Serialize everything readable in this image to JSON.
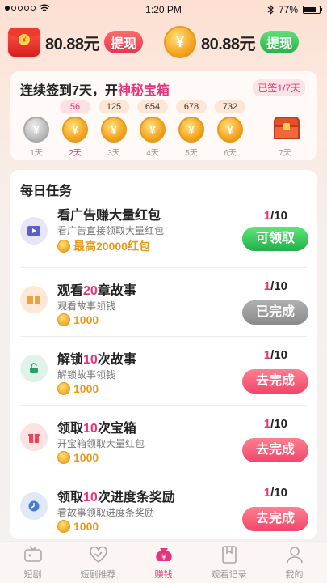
{
  "status": {
    "time": "1:20 PM",
    "battery": "77%",
    "battery_level": 0.77
  },
  "balances": [
    {
      "amount": "80.88元",
      "button": "提现",
      "coin_glyph": "¥"
    },
    {
      "amount": "80.88元",
      "button": "提现",
      "coin_glyph": "¥"
    }
  ],
  "signin": {
    "title_prefix": "连续签到7天，开",
    "title_highlight": "神秘宝箱",
    "badge": "已签1/7天",
    "days": [
      {
        "reward": "",
        "label": "1天",
        "state": "done"
      },
      {
        "reward": "56",
        "label": "2天",
        "state": "today"
      },
      {
        "reward": "125",
        "label": "3天",
        "state": "pending"
      },
      {
        "reward": "654",
        "label": "4天",
        "state": "pending"
      },
      {
        "reward": "678",
        "label": "5天",
        "state": "pending"
      },
      {
        "reward": "732",
        "label": "6天",
        "state": "pending"
      },
      {
        "reward": "",
        "label": "7天",
        "state": "chest"
      }
    ]
  },
  "tasks": {
    "title": "每日任务",
    "items": [
      {
        "name_a": "看广告赚大量红包",
        "name_b": "",
        "name_c": "",
        "desc": "看广告直接领取大量红包",
        "reward": "最高20000红包",
        "done": "1",
        "total": "/10",
        "action": "可领取",
        "action_style": "green",
        "icon": "video-icon"
      },
      {
        "name_a": "观看",
        "name_b": "20",
        "name_c": "章故事",
        "desc": "观看故事领钱",
        "reward": "1000",
        "done": "1",
        "total": "/10",
        "action": "已完成",
        "action_style": "gray",
        "icon": "book-icon"
      },
      {
        "name_a": "解锁",
        "name_b": "10",
        "name_c": "次故事",
        "desc": "解锁故事领钱",
        "reward": "1000",
        "done": "1",
        "total": "/10",
        "action": "去完成",
        "action_style": "pink",
        "icon": "unlock-icon"
      },
      {
        "name_a": "领取",
        "name_b": "10",
        "name_c": "次宝箱",
        "desc": "开宝箱领取大量红包",
        "reward": "1000",
        "done": "1",
        "total": "/10",
        "action": "去完成",
        "action_style": "pink",
        "icon": "gift-icon"
      },
      {
        "name_a": "领取",
        "name_b": "10",
        "name_c": "次进度条奖励",
        "desc": "看故事领取进度条奖励",
        "reward": "1000",
        "done": "1",
        "total": "/10",
        "action": "去完成",
        "action_style": "pink",
        "icon": "clock-icon"
      }
    ]
  },
  "tabbar": [
    {
      "label": "短剧",
      "icon": "tv-icon"
    },
    {
      "label": "短剧推荐",
      "icon": "heart-check-icon"
    },
    {
      "label": "赚钱",
      "icon": "money-bag-icon",
      "active": true
    },
    {
      "label": "观看记录",
      "icon": "bookmark-icon"
    },
    {
      "label": "我的",
      "icon": "user-icon"
    }
  ],
  "colors": {
    "accent": "#e8337a",
    "coin": "#f5a623",
    "green": "#27b24a"
  }
}
